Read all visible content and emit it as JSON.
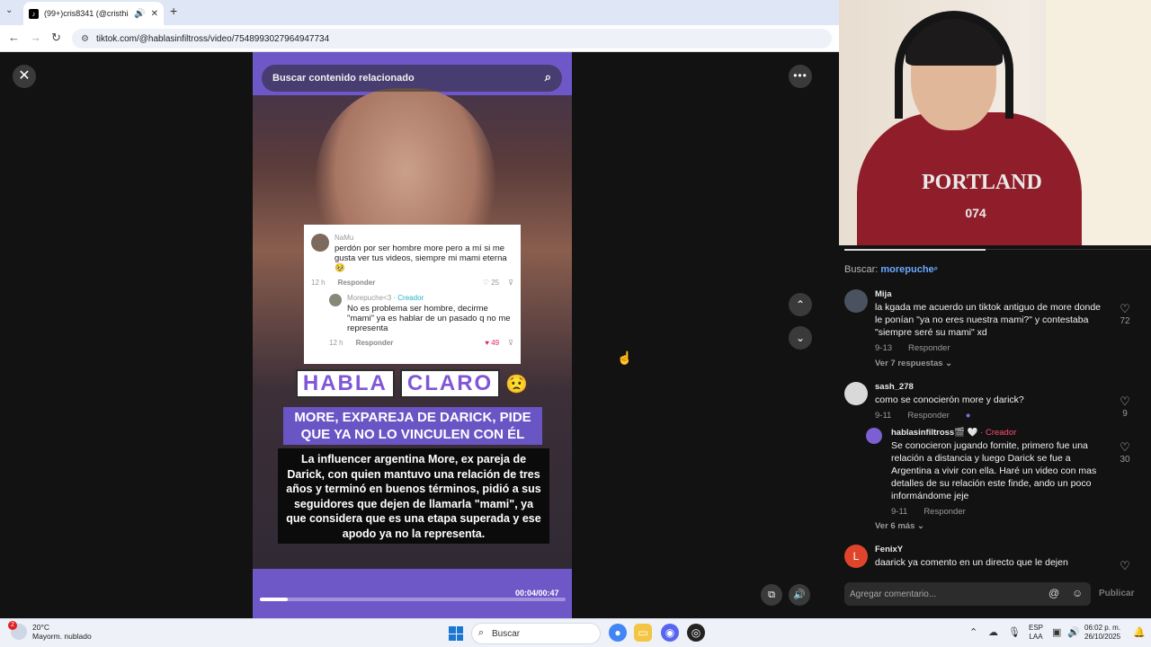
{
  "browser": {
    "tab_title": "(99+)cris8341 (@cristhian8",
    "url": "tiktok.com/@hablasinfiltross/video/7548993027964947734"
  },
  "video": {
    "search_placeholder": "Buscar contenido relacionado",
    "timecode": "00:04/00:47",
    "progress": 0.09,
    "embedded_comment": {
      "user": "NaMu",
      "text": "perdón por ser hombre more pero a mí si me gusta ver tus videos, siempre mi mami eterna 🥹",
      "time": "12 h",
      "reply_label": "Responder",
      "likes": "25",
      "reply": {
        "user": "Morepuche<3",
        "creator_tag": "· Creador",
        "text": "No es problema ser hombre, decirme \"mami\" ya es hablar de un pasado q no me representa",
        "time": "12 h",
        "reply_label": "Responder",
        "likes": "49"
      }
    },
    "badge_words": [
      "HABLA",
      "CLARO"
    ],
    "headline": "MORE, EXPAREJA DE DARICK, PIDE QUE YA NO LO VINCULEN CON ÉL",
    "summary": "La influencer argentina More, ex pareja de Darick, con quien mantuvo una relación de tres años y terminó en buenos términos, pidió a sus seguidores que dejen de llamarla \"mami\", ya que considera que es una etapa superada y ese apodo ya no la representa."
  },
  "webcam": {
    "shirt_text": "PORTLAND",
    "shirt_number": "074"
  },
  "comments": {
    "search_label": "Buscar:",
    "search_term": "morepuche",
    "items": [
      {
        "user": "Mija",
        "text": "la kgada me acuerdo un tiktok antiguo de more donde le ponían \"ya no eres nuestra mami?\" y contestaba \"siempre seré su mami\" xd",
        "date": "9-13",
        "reply_label": "Responder",
        "likes": "72",
        "more": "Ver 7 respuestas ⌄"
      },
      {
        "user": "sash_278",
        "text": "como se conocierón more y darick?",
        "date": "9-11",
        "reply_label": "Responder",
        "likes": "9"
      },
      {
        "user": "hablasinfiltross🎬 🤍",
        "creator_tag": "· Creador",
        "text": "Se conocieron jugando fornite, primero fue una relación a distancia y luego Darick se fue a Argentina a vivir con ella. Haré un video con mas detalles de su relación este finde, ando un poco informándome jeje",
        "date": "9-11",
        "reply_label": "Responder",
        "likes": "30",
        "more": "Ver 6 más ⌄"
      },
      {
        "user": "FenixY",
        "avatar_letter": "L",
        "text": "daarick ya comento en un directo que le dejen"
      }
    ],
    "compose_placeholder": "Agregar comentario...",
    "publish_label": "Publicar"
  },
  "taskbar": {
    "temperature": "20°C",
    "weather_text": "Mayorm. nublado",
    "weather_badge": "2",
    "search_label": "Buscar",
    "lang_top": "ESP",
    "lang_bottom": "LAA",
    "time": "06:02 p. m.",
    "date": "26/10/2025"
  },
  "colors": {
    "accent_purple": "#6a55c5",
    "creator_red": "#ff4d6d",
    "search_link": "#6aa8ff",
    "like_red": "#e0245e"
  }
}
